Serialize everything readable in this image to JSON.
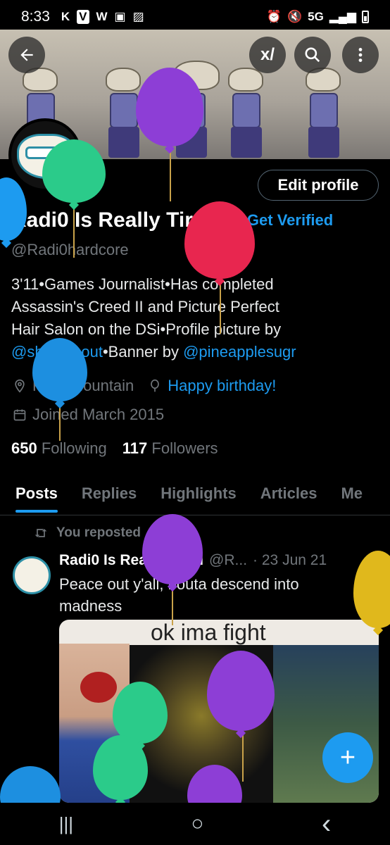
{
  "status_bar": {
    "time": "8:33",
    "left_glyphs": [
      "K",
      "V",
      "W",
      "▣",
      "▨"
    ],
    "network": "5G"
  },
  "header": {
    "back_icon": "back-arrow-icon",
    "grok_icon": "grok-icon",
    "search_icon": "search-icon",
    "more_icon": "more-vertical-icon"
  },
  "profile": {
    "edit_label": "Edit profile",
    "display_name": "Radi0 Is Really Tired",
    "get_verified": "Get Verified",
    "handle": "@Radi0hardcore",
    "bio_lines": [
      "3'11•Games Journalist•Has completed",
      "Assassin's Creed II and Picture Perfect",
      "Hair Salon on the DSi•Profile picture by"
    ],
    "bio_link1": "@sharksnout",
    "bio_mid": "•Banner by ",
    "bio_link2": "@pineapplesugr",
    "location": "Fuck Mountain",
    "birthday": "Happy birthday!",
    "joined": "Joined March 2015",
    "following_count": "650",
    "following_label": "Following",
    "followers_count": "117",
    "followers_label": "Followers"
  },
  "tabs": [
    "Posts",
    "Replies",
    "Highlights",
    "Articles",
    "Me"
  ],
  "post": {
    "repost_label": "You reposted",
    "name": "Radi0 Is Really Tired",
    "handle": "@R...",
    "date": "· 23 Jun 21",
    "text_lines": [
      "Peace out y'all, bouta descend into",
      "madness"
    ],
    "image_caption": "ok ima fight"
  },
  "fab_label": "+",
  "nav": {
    "recents": "|||",
    "home": "○",
    "back": "‹"
  },
  "colors": {
    "accent": "#1d9bf0",
    "background": "#000000",
    "muted": "#71767b"
  }
}
